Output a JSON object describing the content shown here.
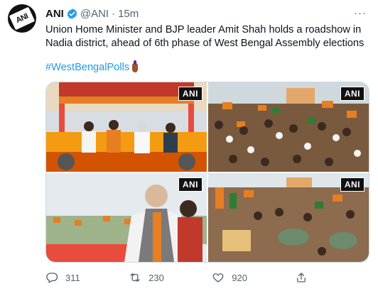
{
  "tweet": {
    "author_name": "ANI",
    "handle": "@ANI",
    "separator": "·",
    "time": "15m",
    "text": "Union Home Minister and BJP leader Amit Shah holds a roadshow in Nadia district, ahead of 6th phase of West Bengal Assembly elections",
    "hashtag": "#WestBengalPolls",
    "avatar_logo": "ANI",
    "photo_watermark": "ANI",
    "more_label": "···"
  },
  "actions": {
    "replies": "311",
    "retweets": "230",
    "likes": "920"
  },
  "colors": {
    "link": "#1d9bf0",
    "verified": "#1d9bf0",
    "muted": "#536471"
  },
  "icons": [
    "verified-badge-icon",
    "more-options-icon",
    "reply-icon",
    "retweet-icon",
    "like-icon",
    "share-icon"
  ]
}
